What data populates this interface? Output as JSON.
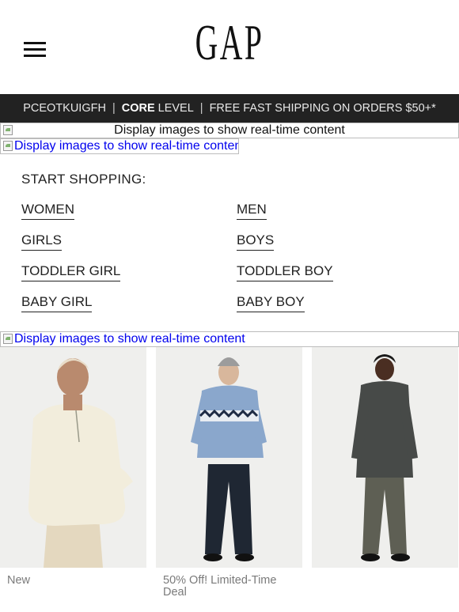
{
  "header": {
    "logo_text": "GAP",
    "menu_icon": "hamburger-menu-icon"
  },
  "banner": {
    "customer": "PCEOTKUIGFH",
    "separator": "|",
    "level_bold": "CORE",
    "level_rest": "LEVEL",
    "shipping": "FREE FAST SHIPPING ON ORDERS $50+*"
  },
  "image_placeholder_text": "Display images to show real-time content",
  "shop": {
    "title": "START SHOPPING:",
    "categories": [
      "WOMEN",
      "MEN",
      "GIRLS",
      "BOYS",
      "TODDLER GIRL",
      "TODDLER BOY",
      "BABY GIRL",
      "BABY BOY"
    ]
  },
  "products": [
    {
      "caption": "New"
    },
    {
      "caption": "50% Off! Limited-Time Deal"
    },
    {
      "caption": ""
    }
  ],
  "colors": {
    "banner_bg": "#222222",
    "link": "#0000ee",
    "caption": "#7a7a7a"
  }
}
